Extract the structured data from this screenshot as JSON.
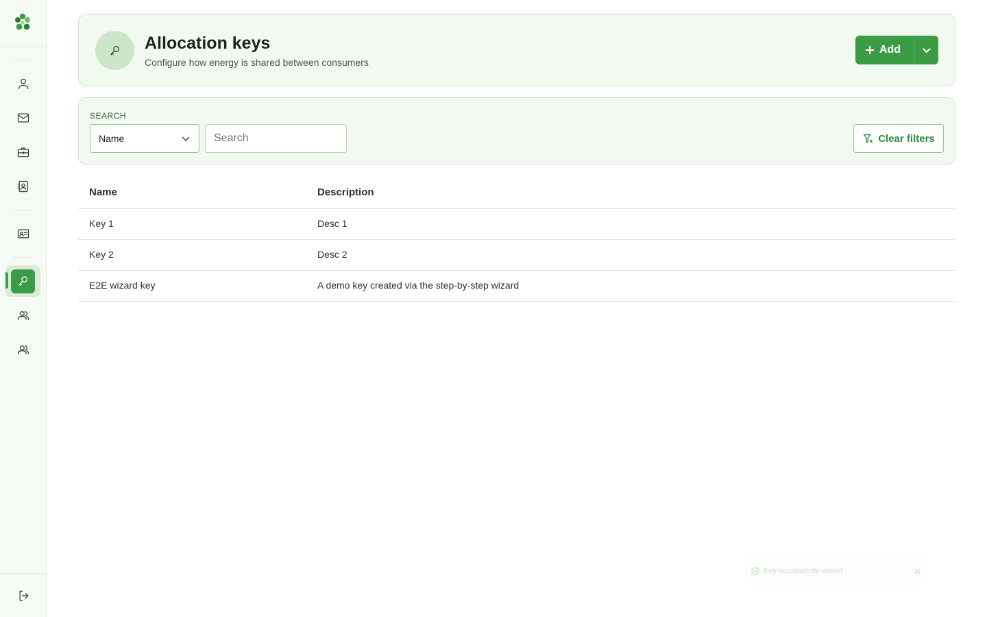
{
  "colors": {
    "accent": "#3b9c45",
    "card_bg": "#f2f9f1",
    "card_border": "#c8e3c4",
    "sidebar_bg": "#f6faf5"
  },
  "sidebar": {
    "logo_icon": "clover-logo-icon",
    "items": [
      {
        "name": "user",
        "icon": "user-icon"
      },
      {
        "name": "mail",
        "icon": "mail-icon"
      },
      {
        "name": "briefcase",
        "icon": "briefcase-icon"
      },
      {
        "name": "contacts",
        "icon": "contact-book-icon"
      },
      {
        "name": "id-card",
        "icon": "id-card-icon"
      },
      {
        "name": "allocation-keys",
        "icon": "key-icon",
        "active": true
      },
      {
        "name": "consumers",
        "icon": "users-icon"
      },
      {
        "name": "groups",
        "icon": "users-icon"
      }
    ],
    "logout_icon": "logout-icon"
  },
  "header": {
    "icon": "key-icon",
    "title": "Allocation keys",
    "subtitle": "Configure how energy is shared between consumers",
    "add_label": "Add"
  },
  "search": {
    "label": "SEARCH",
    "field_selected": "Name",
    "placeholder": "Search",
    "value": "",
    "clear_label": "Clear filters"
  },
  "table": {
    "columns": [
      "Name",
      "Description"
    ],
    "rows": [
      {
        "name": "Key 1",
        "description": "Desc 1"
      },
      {
        "name": "Key 2",
        "description": "Desc 2"
      },
      {
        "name": "E2E wizard key",
        "description": "A demo key created via the step-by-step wizard"
      }
    ]
  },
  "toast": {
    "message": "Key successfully added"
  }
}
